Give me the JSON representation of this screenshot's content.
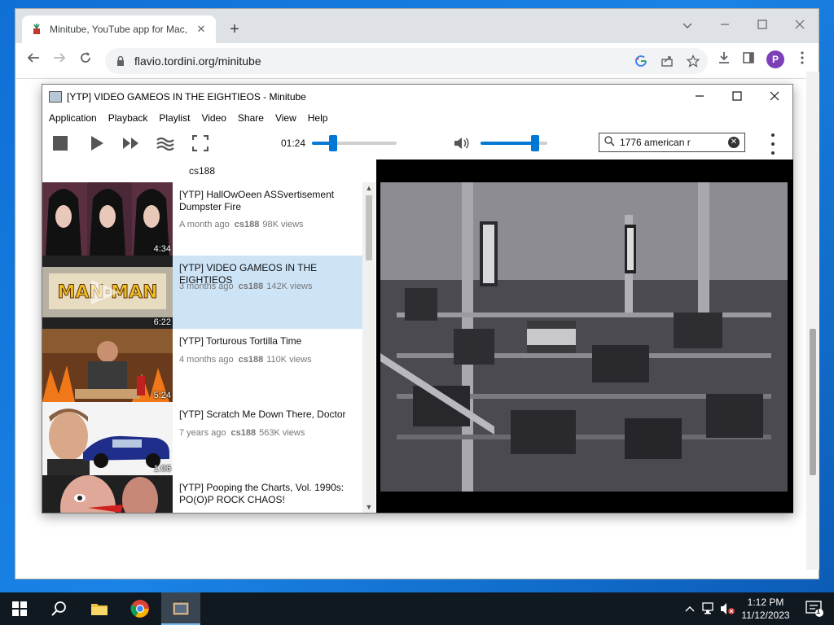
{
  "chrome": {
    "tab_title": "Minitube, YouTube app for Mac, Windows, Linux",
    "tab_close": "✕",
    "new_tab": "+",
    "url": "flavio.tordini.org/minitube",
    "profile_initial": "P"
  },
  "minitube": {
    "window_title": "[YTP] VIDEO GAMEOS IN THE EIGHTIEOS - Minitube",
    "menu": [
      "Application",
      "Playback",
      "Playlist",
      "Video",
      "Share",
      "View",
      "Help"
    ],
    "time": "01:24",
    "seek_fraction": 0.25,
    "volume_fraction": 0.82,
    "search_value": "1776 american r",
    "playlist_header": "cs188",
    "items": [
      {
        "title": "[YTP] HallOwOeen ASSvertisement Dumpster Fire",
        "age": "A month ago",
        "channel": "cs188",
        "views": "98K views",
        "duration": "4:34"
      },
      {
        "title": "[YTP] VIDEO GAMEOS IN THE EIGHTIEOS",
        "age": "3 months ago",
        "channel": "cs188",
        "views": "142K views",
        "duration": "6:22"
      },
      {
        "title": "[YTP] Torturous Tortilla Time",
        "age": "4 months ago",
        "channel": "cs188",
        "views": "110K views",
        "duration": "5:24"
      },
      {
        "title": "[YTP] Scratch Me Down There, Doctor",
        "age": "7 years ago",
        "channel": "cs188",
        "views": "563K views",
        "duration": "1:06"
      },
      {
        "title": "[YTP] Pooping the Charts, Vol. 1990s: PO(O)P ROCK CHAOS!",
        "age": "",
        "channel": "",
        "views": "",
        "duration": ""
      }
    ]
  },
  "taskbar": {
    "time": "1:12 PM",
    "date": "11/12/2023",
    "notification_count": "1"
  }
}
